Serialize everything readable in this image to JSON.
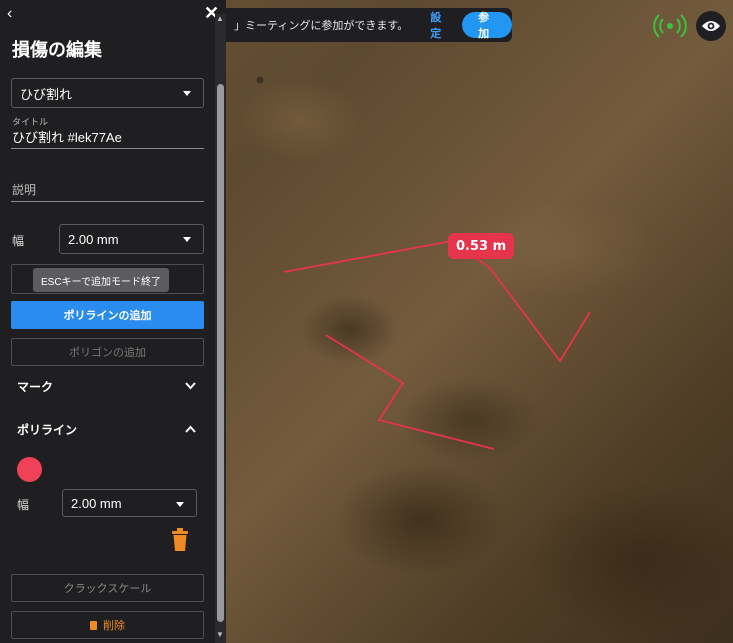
{
  "notification": {
    "message": "」ミーティングに参加ができます。",
    "settings_label": "設定",
    "join_label": "参加"
  },
  "measurement": {
    "label": "0.53 m"
  },
  "panel": {
    "back_glyph": "‹",
    "close_glyph": "✕",
    "title": "損傷の編集",
    "type_select_value": "ひび割れ",
    "title_field_label": "タイトル",
    "title_field_value": "ひび割れ #lek77Ae",
    "description_placeholder": "説明",
    "width_label": "幅",
    "width_value": "2.00 mm",
    "tooltip": "ESCキーで追加モード終了",
    "add_polyline_label": "ポリラインの追加",
    "add_polygon_label": "ポリゴンの追加",
    "mark_section_label": "マーク",
    "polyline_section_label": "ポリライン",
    "polyline_color": "#ef4158",
    "polyline_width_label": "幅",
    "polyline_width_value": "2.00 mm",
    "crack_scale_label": "クラックスケール",
    "delete_label": "削除"
  },
  "colors": {
    "accent_blue": "#2b8cf0",
    "crack_red": "#e5344c",
    "delete_orange": "#f08a24",
    "sync_green": "#3cc23c"
  }
}
